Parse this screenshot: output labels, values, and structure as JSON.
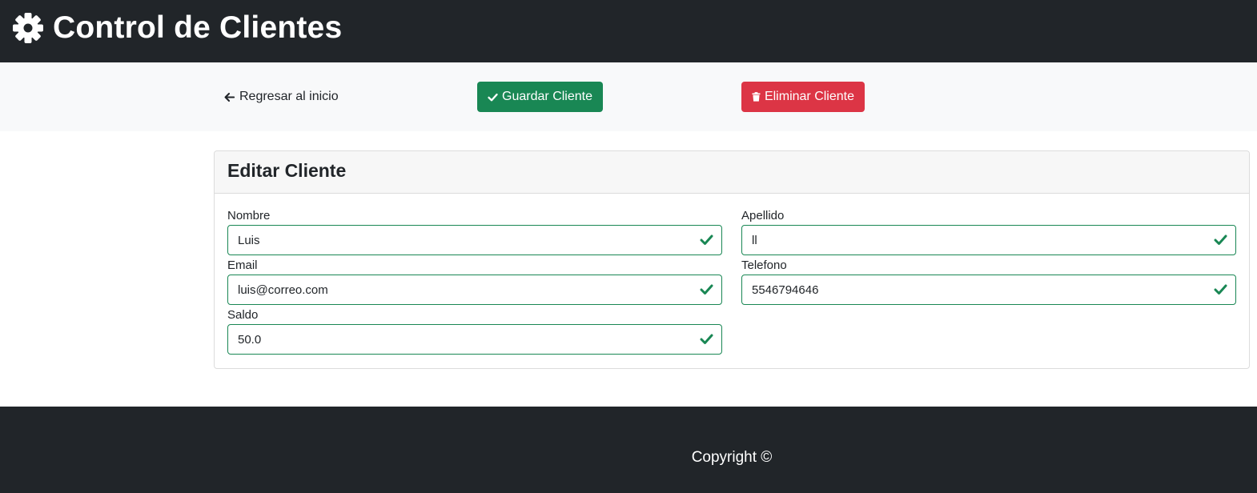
{
  "header": {
    "title": "Control de Clientes",
    "icon": "gear-icon"
  },
  "actions": {
    "back_label": "Regresar al inicio",
    "save_label": "Guardar Cliente",
    "delete_label": "Eliminar Cliente"
  },
  "card": {
    "title": "Editar Cliente"
  },
  "form": {
    "nombre": {
      "label": "Nombre",
      "value": "Luis"
    },
    "apellido": {
      "label": "Apellido",
      "value": "ll"
    },
    "email": {
      "label": "Email",
      "value": "luis@correo.com"
    },
    "telefono": {
      "label": "Telefono",
      "value": "5546794646"
    },
    "saldo": {
      "label": "Saldo",
      "value": "50.0"
    }
  },
  "footer": {
    "copyright": "Copyright ©"
  },
  "colors": {
    "dark": "#212529",
    "success": "#198754",
    "danger": "#dc3545",
    "light": "#f8f9fa"
  }
}
